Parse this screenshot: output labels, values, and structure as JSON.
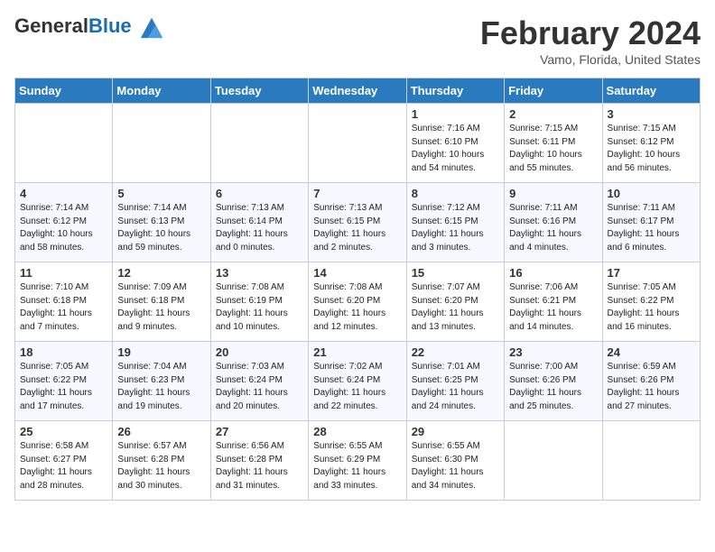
{
  "header": {
    "logo_general": "General",
    "logo_blue": "Blue",
    "month_title": "February 2024",
    "location": "Vamo, Florida, United States"
  },
  "days_of_week": [
    "Sunday",
    "Monday",
    "Tuesday",
    "Wednesday",
    "Thursday",
    "Friday",
    "Saturday"
  ],
  "weeks": [
    [
      {
        "day": "",
        "info": ""
      },
      {
        "day": "",
        "info": ""
      },
      {
        "day": "",
        "info": ""
      },
      {
        "day": "",
        "info": ""
      },
      {
        "day": "1",
        "info": "Sunrise: 7:16 AM\nSunset: 6:10 PM\nDaylight: 10 hours\nand 54 minutes."
      },
      {
        "day": "2",
        "info": "Sunrise: 7:15 AM\nSunset: 6:11 PM\nDaylight: 10 hours\nand 55 minutes."
      },
      {
        "day": "3",
        "info": "Sunrise: 7:15 AM\nSunset: 6:12 PM\nDaylight: 10 hours\nand 56 minutes."
      }
    ],
    [
      {
        "day": "4",
        "info": "Sunrise: 7:14 AM\nSunset: 6:12 PM\nDaylight: 10 hours\nand 58 minutes."
      },
      {
        "day": "5",
        "info": "Sunrise: 7:14 AM\nSunset: 6:13 PM\nDaylight: 10 hours\nand 59 minutes."
      },
      {
        "day": "6",
        "info": "Sunrise: 7:13 AM\nSunset: 6:14 PM\nDaylight: 11 hours\nand 0 minutes."
      },
      {
        "day": "7",
        "info": "Sunrise: 7:13 AM\nSunset: 6:15 PM\nDaylight: 11 hours\nand 2 minutes."
      },
      {
        "day": "8",
        "info": "Sunrise: 7:12 AM\nSunset: 6:15 PM\nDaylight: 11 hours\nand 3 minutes."
      },
      {
        "day": "9",
        "info": "Sunrise: 7:11 AM\nSunset: 6:16 PM\nDaylight: 11 hours\nand 4 minutes."
      },
      {
        "day": "10",
        "info": "Sunrise: 7:11 AM\nSunset: 6:17 PM\nDaylight: 11 hours\nand 6 minutes."
      }
    ],
    [
      {
        "day": "11",
        "info": "Sunrise: 7:10 AM\nSunset: 6:18 PM\nDaylight: 11 hours\nand 7 minutes."
      },
      {
        "day": "12",
        "info": "Sunrise: 7:09 AM\nSunset: 6:18 PM\nDaylight: 11 hours\nand 9 minutes."
      },
      {
        "day": "13",
        "info": "Sunrise: 7:08 AM\nSunset: 6:19 PM\nDaylight: 11 hours\nand 10 minutes."
      },
      {
        "day": "14",
        "info": "Sunrise: 7:08 AM\nSunset: 6:20 PM\nDaylight: 11 hours\nand 12 minutes."
      },
      {
        "day": "15",
        "info": "Sunrise: 7:07 AM\nSunset: 6:20 PM\nDaylight: 11 hours\nand 13 minutes."
      },
      {
        "day": "16",
        "info": "Sunrise: 7:06 AM\nSunset: 6:21 PM\nDaylight: 11 hours\nand 14 minutes."
      },
      {
        "day": "17",
        "info": "Sunrise: 7:05 AM\nSunset: 6:22 PM\nDaylight: 11 hours\nand 16 minutes."
      }
    ],
    [
      {
        "day": "18",
        "info": "Sunrise: 7:05 AM\nSunset: 6:22 PM\nDaylight: 11 hours\nand 17 minutes."
      },
      {
        "day": "19",
        "info": "Sunrise: 7:04 AM\nSunset: 6:23 PM\nDaylight: 11 hours\nand 19 minutes."
      },
      {
        "day": "20",
        "info": "Sunrise: 7:03 AM\nSunset: 6:24 PM\nDaylight: 11 hours\nand 20 minutes."
      },
      {
        "day": "21",
        "info": "Sunrise: 7:02 AM\nSunset: 6:24 PM\nDaylight: 11 hours\nand 22 minutes."
      },
      {
        "day": "22",
        "info": "Sunrise: 7:01 AM\nSunset: 6:25 PM\nDaylight: 11 hours\nand 24 minutes."
      },
      {
        "day": "23",
        "info": "Sunrise: 7:00 AM\nSunset: 6:26 PM\nDaylight: 11 hours\nand 25 minutes."
      },
      {
        "day": "24",
        "info": "Sunrise: 6:59 AM\nSunset: 6:26 PM\nDaylight: 11 hours\nand 27 minutes."
      }
    ],
    [
      {
        "day": "25",
        "info": "Sunrise: 6:58 AM\nSunset: 6:27 PM\nDaylight: 11 hours\nand 28 minutes."
      },
      {
        "day": "26",
        "info": "Sunrise: 6:57 AM\nSunset: 6:28 PM\nDaylight: 11 hours\nand 30 minutes."
      },
      {
        "day": "27",
        "info": "Sunrise: 6:56 AM\nSunset: 6:28 PM\nDaylight: 11 hours\nand 31 minutes."
      },
      {
        "day": "28",
        "info": "Sunrise: 6:55 AM\nSunset: 6:29 PM\nDaylight: 11 hours\nand 33 minutes."
      },
      {
        "day": "29",
        "info": "Sunrise: 6:55 AM\nSunset: 6:30 PM\nDaylight: 11 hours\nand 34 minutes."
      },
      {
        "day": "",
        "info": ""
      },
      {
        "day": "",
        "info": ""
      }
    ]
  ]
}
